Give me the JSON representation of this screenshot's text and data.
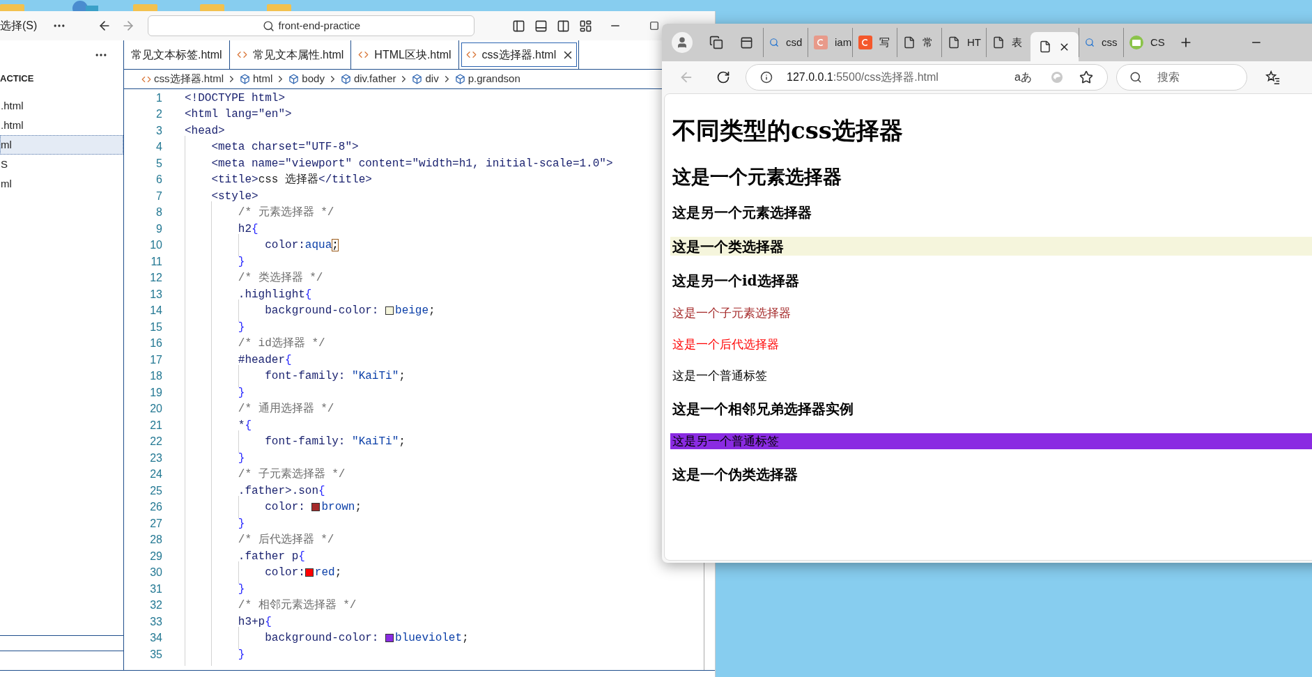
{
  "vscode": {
    "menu": "选择(S)",
    "search": "front-end-practice",
    "sidebar": {
      "header": "ACTICE",
      "files": [
        {
          "label": ".html",
          "selected": false
        },
        {
          "label": ".html",
          "selected": false
        },
        {
          "label": "ml",
          "selected": true
        },
        {
          "label": "S",
          "selected": false
        },
        {
          "label": "ml",
          "selected": false
        }
      ]
    },
    "tabs": [
      {
        "label": "常见文本标签.html",
        "icon": false,
        "selected": false
      },
      {
        "label": "常见文本属性.html",
        "icon": true,
        "selected": false
      },
      {
        "label": "HTML区块.html",
        "icon": true,
        "selected": false
      },
      {
        "label": "css选择器.html",
        "icon": true,
        "selected": true
      }
    ],
    "breadcrumb": [
      {
        "label": "css选择器.html",
        "kind": "file"
      },
      {
        "label": "html",
        "kind": "element"
      },
      {
        "label": "body",
        "kind": "element"
      },
      {
        "label": "div.father",
        "kind": "element"
      },
      {
        "label": "div",
        "kind": "element"
      },
      {
        "label": "p.grandson",
        "kind": "element"
      }
    ],
    "code": [
      {
        "n": "1",
        "tokens": [
          {
            "kind": "tag",
            "text": "<!DOCTYPE html>"
          }
        ]
      },
      {
        "n": "2",
        "tokens": [
          {
            "kind": "tag",
            "text": "<html lang="
          },
          {
            "kind": "string",
            "text": "\"en\""
          },
          {
            "kind": "tag",
            "text": ">"
          }
        ]
      },
      {
        "n": "3",
        "tokens": [
          {
            "kind": "tag",
            "text": "<head>"
          }
        ]
      },
      {
        "n": "4",
        "tokens": [
          {
            "kind": "tag",
            "text": "    <meta charset="
          },
          {
            "kind": "string",
            "text": "\"UTF-8\""
          },
          {
            "kind": "tag",
            "text": ">"
          }
        ]
      },
      {
        "n": "5",
        "tokens": [
          {
            "kind": "tag",
            "text": "    <meta name="
          },
          {
            "kind": "string",
            "text": "\"viewport\""
          },
          {
            "kind": "tag",
            "text": " content="
          },
          {
            "kind": "string",
            "text": "\"width=h1, initial-scale=1.0\""
          },
          {
            "kind": "tag",
            "text": ">"
          }
        ]
      },
      {
        "n": "6",
        "tokens": [
          {
            "kind": "tag",
            "text": "    <title>"
          },
          {
            "kind": "plain",
            "text": "css 选择器"
          },
          {
            "kind": "tag",
            "text": "</title>"
          }
        ]
      },
      {
        "n": "7",
        "tokens": [
          {
            "kind": "tag",
            "text": "    <style>"
          }
        ]
      },
      {
        "n": "8",
        "tokens": [
          {
            "kind": "comment",
            "text": "        /* 元素选择器 */"
          }
        ]
      },
      {
        "n": "9",
        "tokens": [
          {
            "kind": "selector",
            "text": "        h2"
          },
          {
            "kind": "brace",
            "text": "{"
          }
        ]
      },
      {
        "n": "10",
        "tokens": [
          {
            "kind": "prop",
            "text": "            color:"
          },
          {
            "kind": "value",
            "text": "aqua"
          },
          {
            "kind": "cursor",
            "text": ";"
          }
        ]
      },
      {
        "n": "11",
        "tokens": [
          {
            "kind": "brace",
            "text": "        }"
          }
        ]
      },
      {
        "n": "12",
        "tokens": [
          {
            "kind": "comment",
            "text": "        /* 类选择器 */"
          }
        ]
      },
      {
        "n": "13",
        "tokens": [
          {
            "kind": "selector",
            "text": "        .highlight"
          },
          {
            "kind": "brace",
            "text": "{"
          }
        ]
      },
      {
        "n": "14",
        "tokens": [
          {
            "kind": "prop",
            "text": "            background-color: "
          },
          {
            "kind": "swatch",
            "color": "#f5f5dc"
          },
          {
            "kind": "value",
            "text": "beige"
          },
          {
            "kind": "plain",
            "text": ";"
          }
        ]
      },
      {
        "n": "15",
        "tokens": [
          {
            "kind": "brace",
            "text": "        }"
          }
        ]
      },
      {
        "n": "16",
        "tokens": [
          {
            "kind": "comment",
            "text": "        /* id选择器 */"
          }
        ]
      },
      {
        "n": "17",
        "tokens": [
          {
            "kind": "selector",
            "text": "        #header"
          },
          {
            "kind": "brace",
            "text": "{"
          }
        ]
      },
      {
        "n": "18",
        "tokens": [
          {
            "kind": "prop",
            "text": "            font-family: "
          },
          {
            "kind": "value",
            "text": "\"KaiTi\""
          },
          {
            "kind": "plain",
            "text": ";"
          }
        ]
      },
      {
        "n": "19",
        "tokens": [
          {
            "kind": "brace",
            "text": "        }"
          }
        ]
      },
      {
        "n": "20",
        "tokens": [
          {
            "kind": "comment",
            "text": "        /* 通用选择器 */"
          }
        ]
      },
      {
        "n": "21",
        "tokens": [
          {
            "kind": "selector",
            "text": "        *"
          },
          {
            "kind": "brace",
            "text": "{"
          }
        ]
      },
      {
        "n": "22",
        "tokens": [
          {
            "kind": "prop",
            "text": "            font-family: "
          },
          {
            "kind": "value",
            "text": "\"KaiTi\""
          },
          {
            "kind": "plain",
            "text": ";"
          }
        ]
      },
      {
        "n": "23",
        "tokens": [
          {
            "kind": "brace",
            "text": "        }"
          }
        ]
      },
      {
        "n": "24",
        "tokens": [
          {
            "kind": "comment",
            "text": "        /* 子元素选择器 */"
          }
        ]
      },
      {
        "n": "25",
        "tokens": [
          {
            "kind": "selector",
            "text": "        .father>.son"
          },
          {
            "kind": "brace",
            "text": "{"
          }
        ]
      },
      {
        "n": "26",
        "tokens": [
          {
            "kind": "prop",
            "text": "            color: "
          },
          {
            "kind": "swatch",
            "color": "#a52a2a"
          },
          {
            "kind": "value",
            "text": "brown"
          },
          {
            "kind": "plain",
            "text": ";"
          }
        ]
      },
      {
        "n": "27",
        "tokens": [
          {
            "kind": "brace",
            "text": "        }"
          }
        ]
      },
      {
        "n": "28",
        "tokens": [
          {
            "kind": "comment",
            "text": "        /* 后代选择器 */"
          }
        ]
      },
      {
        "n": "29",
        "tokens": [
          {
            "kind": "selector",
            "text": "        .father p"
          },
          {
            "kind": "brace",
            "text": "{"
          }
        ]
      },
      {
        "n": "30",
        "tokens": [
          {
            "kind": "prop",
            "text": "            color:"
          },
          {
            "kind": "swatch",
            "color": "#ff0000"
          },
          {
            "kind": "value",
            "text": "red"
          },
          {
            "kind": "plain",
            "text": ";"
          }
        ]
      },
      {
        "n": "31",
        "tokens": [
          {
            "kind": "brace",
            "text": "        }"
          }
        ]
      },
      {
        "n": "32",
        "tokens": [
          {
            "kind": "comment",
            "text": "        /* 相邻元素选择器 */"
          }
        ]
      },
      {
        "n": "33",
        "tokens": [
          {
            "kind": "selector",
            "text": "        h3+p"
          },
          {
            "kind": "brace",
            "text": "{"
          }
        ]
      },
      {
        "n": "34",
        "tokens": [
          {
            "kind": "prop",
            "text": "            background-color: "
          },
          {
            "kind": "swatch",
            "color": "#8a2be2"
          },
          {
            "kind": "value",
            "text": "blueviolet"
          },
          {
            "kind": "plain",
            "text": ";"
          }
        ]
      },
      {
        "n": "35",
        "tokens": [
          {
            "kind": "brace",
            "text": "        }"
          }
        ]
      }
    ]
  },
  "browser": {
    "tabs": [
      {
        "kind": "search",
        "label": "csd",
        "selected": false
      },
      {
        "kind": "c",
        "label": "iam",
        "color": "#e89a8a",
        "selected": false
      },
      {
        "kind": "c",
        "label": "写",
        "color": "#f4582c",
        "selected": false
      },
      {
        "kind": "doc",
        "label": "常",
        "selected": false
      },
      {
        "kind": "doc",
        "label": "HT",
        "selected": false
      },
      {
        "kind": "doc",
        "label": "表",
        "selected": false
      },
      {
        "kind": "doc",
        "selected": true
      },
      {
        "kind": "search",
        "label": "css",
        "selected": false
      },
      {
        "kind": "code",
        "label": "CS",
        "selected": false
      }
    ],
    "back_disabled": true,
    "url_host": "127.0.0.1",
    "url_path": ":5500/css选择器.html",
    "read_aloud": "aあ",
    "search_placeholder": "搜索",
    "content": [
      {
        "kind": "h1",
        "text": "不同类型的css选择器",
        "color": "#000000"
      },
      {
        "kind": "h2",
        "text": "这是一个元素选择器",
        "color": "#000000"
      },
      {
        "kind": "h3",
        "text": "这是另一个元素选择器",
        "color": "#000000"
      },
      {
        "kind": "h3",
        "text": "这是一个类选择器",
        "color": "#000000",
        "highlight": {
          "color": "#f5f5dc"
        }
      },
      {
        "kind": "h3",
        "text": "这是另一个id选择器",
        "color": "#000000"
      },
      {
        "kind": "p",
        "text": "这是一个子元素选择器",
        "color": "#a52a2a"
      },
      {
        "kind": "p",
        "text": "这是一个后代选择器",
        "color": "#ff0000"
      },
      {
        "kind": "p",
        "text": "这是一个普通标签",
        "color": "#000000"
      },
      {
        "kind": "h3",
        "text": "这是一个相邻兄弟选择器实例",
        "color": "#000000"
      },
      {
        "kind": "p",
        "text": "这是另一个普通标签",
        "color": "#000000",
        "highlight": {
          "color": "#8a2be2"
        }
      },
      {
        "kind": "h3",
        "text": "这是一个伪类选择器",
        "color": "#000000"
      }
    ]
  }
}
